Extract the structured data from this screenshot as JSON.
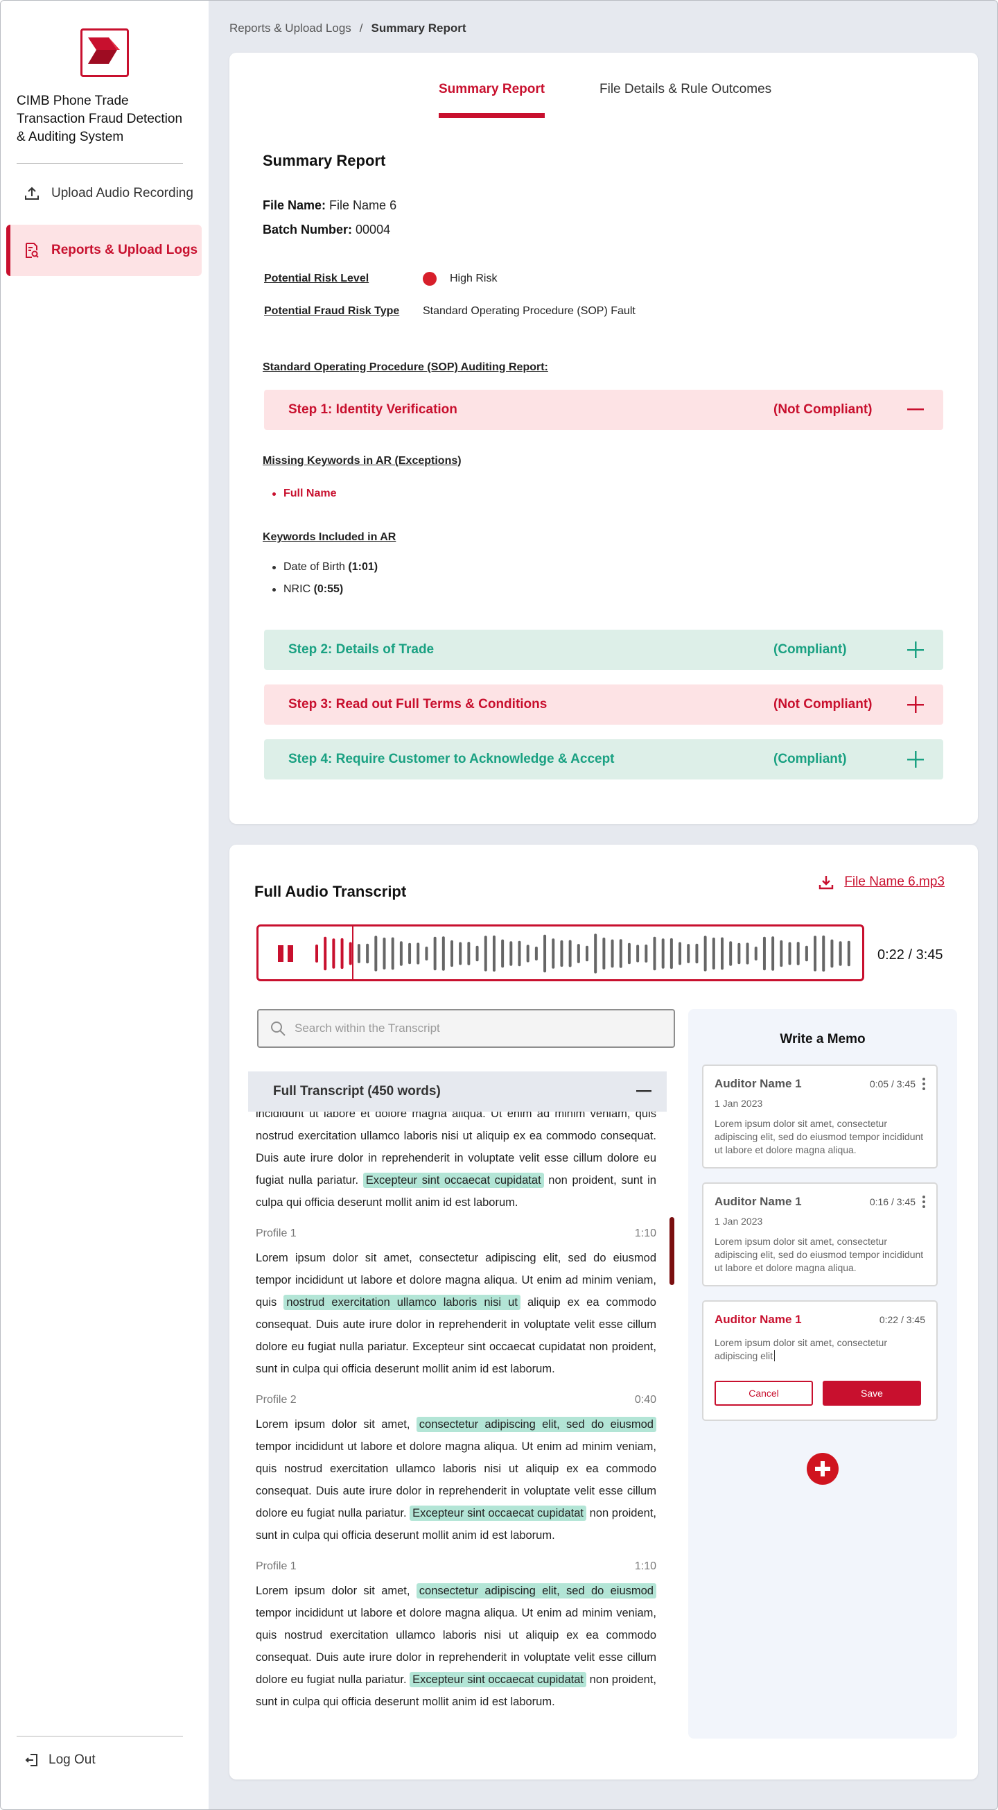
{
  "sidebar": {
    "app_title": "CIMB Phone Trade Transaction Fraud Detection & Auditing System",
    "nav": [
      {
        "label": "Upload Audio Recording",
        "icon": "upload-icon"
      },
      {
        "label": "Reports & Upload Logs",
        "icon": "report-icon",
        "active": true
      }
    ],
    "logout_label": "Log Out"
  },
  "breadcrumb": {
    "parent": "Reports & Upload Logs",
    "separator": "/",
    "current": "Summary Report"
  },
  "tabs": [
    {
      "label": "Summary Report",
      "active": true
    },
    {
      "label": "File Details & Rule Outcomes",
      "active": false
    }
  ],
  "summary": {
    "title": "Summary Report",
    "file_name_label": "File Name:",
    "file_name": "File Name 6",
    "batch_label": "Batch Number:",
    "batch_number": "00004",
    "risk_level_label": "Potential Risk Level",
    "risk_level": "High Risk",
    "risk_type_label": "Potential Fraud Risk Type",
    "risk_type": "Standard Operating Procedure (SOP) Fault",
    "sop_title": "Standard Operating Procedure (SOP) Auditing Report:",
    "missing_title": "Missing Keywords in AR (Exceptions)",
    "missing": [
      "Full Name"
    ],
    "included_title": "Keywords Included in AR",
    "included": [
      {
        "label": "Date of Birth",
        "time": "(1:01)"
      },
      {
        "label": "NRIC",
        "time": "(0:55)"
      }
    ],
    "steps": [
      {
        "name": "Step 1: Identity Verification",
        "status": "(Not Compliant)",
        "expanded": true
      },
      {
        "name": "Step 2: Details of Trade",
        "status": "(Compliant)",
        "expanded": false
      },
      {
        "name": "Step 3: Read out Full Terms & Conditions",
        "status": "(Not Compliant)",
        "expanded": false
      },
      {
        "name": "Step 4: Require Customer to Acknowledge & Accept",
        "status": "(Compliant)",
        "expanded": false
      }
    ]
  },
  "transcript": {
    "title": "Full Audio Transcript",
    "file_link": "File Name 6.mp3",
    "time": "0:22 / 3:45",
    "progress": 0.07,
    "search_placeholder": "Search within the Transcript",
    "section_label": "Full Transcript (450 words)",
    "top_fragment": {
      "a": "incididunt ut labore et dolore magna aliqua. Ut enim ad minim veniam, quis nostrud exercitation ullamco laboris nisi ut aliquip ex ea commodo consequat. Duis aute irure dolor in reprehenderit in voluptate velit esse cillum dolore eu fugiat nulla pariatur.",
      "hl": "Excepteur sint occaecat cupidatat",
      "b": "non proident, sunt in culpa qui officia deserunt mollit anim id est laborum."
    },
    "profiles": [
      {
        "name": "Profile 1",
        "time": "1:10",
        "a": "Lorem ipsum dolor sit amet, consectetur adipiscing elit, sed do eiusmod tempor incididunt ut labore et dolore magna aliqua. Ut enim ad minim veniam, quis",
        "hl1": "nostrud exercitation ullamco laboris nisi ut",
        "b": "aliquip ex ea commodo consequat. Duis aute irure dolor in reprehenderit in voluptate velit esse cillum dolore eu fugiat nulla pariatur. Excepteur sint occaecat cupidatat non proident, sunt in culpa qui officia deserunt mollit anim id est laborum."
      },
      {
        "name": "Profile 2",
        "time": "0:40",
        "a": "Lorem ipsum dolor sit amet,",
        "hl1": "consectetur adipiscing elit, sed do eiusmod",
        "b": "tempor incididunt ut labore et dolore magna aliqua. Ut enim ad minim veniam, quis nostrud exercitation ullamco laboris nisi ut aliquip ex ea commodo consequat. Duis aute irure dolor in reprehenderit in voluptate velit esse cillum dolore eu fugiat nulla pariatur.",
        "hl2": "Excepteur sint occaecat cupidatat",
        "c": "non proident, sunt in culpa qui officia deserunt mollit anim id est laborum."
      },
      {
        "name": "Profile 1",
        "time": "1:10",
        "a": "Lorem ipsum dolor sit amet,",
        "hl1": "consectetur adipiscing elit, sed do eiusmod",
        "b": "tempor incididunt ut labore et dolore magna aliqua. Ut enim ad minim veniam, quis nostrud exercitation ullamco laboris nisi ut aliquip ex ea commodo consequat. Duis aute irure dolor in reprehenderit in voluptate velit esse cillum dolore eu fugiat nulla pariatur.",
        "hl2": "Excepteur sint occaecat cupidatat",
        "c": "non proident, sunt in culpa qui officia deserunt mollit anim id est laborum."
      }
    ]
  },
  "memo": {
    "title": "Write a Memo",
    "items": [
      {
        "author": "Auditor Name 1",
        "time": "0:05 / 3:45",
        "date": "1 Jan 2023",
        "body": "Lorem ipsum dolor sit amet, consectetur adipiscing elit, sed do eiusmod tempor incididunt ut labore et dolore magna aliqua."
      },
      {
        "author": "Auditor Name 1",
        "time": "0:16 / 3:45",
        "date": "1 Jan 2023",
        "body": "Lorem ipsum dolor sit amet, consectetur adipiscing elit, sed do eiusmod tempor incididunt ut labore et dolore magna aliqua."
      }
    ],
    "draft": {
      "author": "Auditor Name 1",
      "time": "0:22 / 3:45",
      "body": "Lorem ipsum dolor sit amet, consectetur adipiscing elit"
    },
    "cancel_label": "Cancel",
    "save_label": "Save"
  },
  "colors": {
    "brand": "#c8102e",
    "compliant": "#1aa182",
    "noncompliant_bg": "#fde3e5",
    "compliant_bg": "#ddefe8",
    "highlight": "#b3e5d6"
  }
}
